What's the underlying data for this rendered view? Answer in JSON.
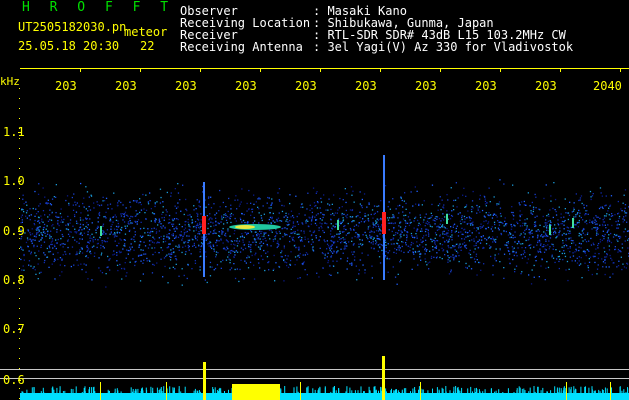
{
  "header": {
    "title": "H R O F F T",
    "filename": "UT2505182030.pn",
    "mode": "meteor",
    "timestamp": "25.05.18 20:30",
    "count": "22"
  },
  "info": [
    {
      "label": "Observer",
      "value": ": Masaki Kano"
    },
    {
      "label": "Receiving Location",
      "value": ": Shibukawa, Gunma, Japan"
    },
    {
      "label": "Receiver",
      "value": ": RTL-SDR SDR# 43dB L15 103.2MHz CW"
    },
    {
      "label": "Receiving Antenna",
      "value": ": 3el Yagi(V) Az 330 for Vladivostok"
    }
  ],
  "axis": {
    "y_unit": "kHz",
    "x_ticks": [
      "203",
      "203",
      "203",
      "203",
      "203",
      "203",
      "203",
      "203",
      "203",
      "2040"
    ],
    "y_ticks": [
      "1.1",
      "1.0",
      "0.9",
      "0.8",
      "0.7",
      "0.6"
    ]
  },
  "colors": {
    "text_yellow": "#ffff00",
    "title_green": "#00e000",
    "echo_red": "#ff2020",
    "baseline_cyan": "#00e0ff"
  }
}
